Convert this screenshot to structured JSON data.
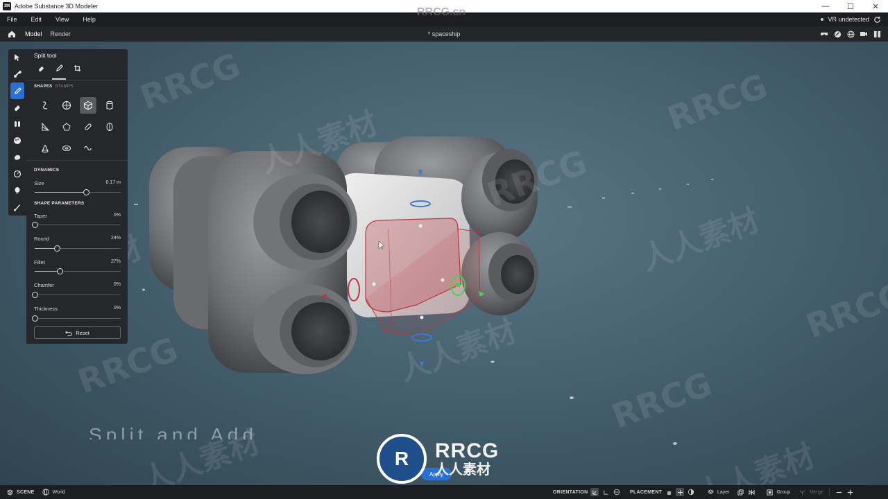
{
  "window": {
    "title": "Adobe Substance 3D Modeler",
    "app_icon_text": "3M",
    "controls": {
      "minimize": "—",
      "maximize": "☐",
      "close": "✕"
    }
  },
  "menu": {
    "items": [
      "File",
      "Edit",
      "View",
      "Help"
    ],
    "vr_status": "VR undetected"
  },
  "toolbar": {
    "tabs": [
      "Model",
      "Render"
    ],
    "active_tab": "Model",
    "document_title": "* spaceship"
  },
  "tool_panel": {
    "title": "Split tool",
    "shape_tabs": {
      "shapes": "SHAPES",
      "stamps": "STAMPS"
    },
    "dynamics": {
      "heading": "DYNAMICS",
      "size": {
        "label": "Size",
        "value": "0.17 m",
        "fraction": 0.6
      }
    },
    "shape_parameters": {
      "heading": "SHAPE PARAMETERS",
      "params": [
        {
          "label": "Taper",
          "value": "0%",
          "fraction": 0.0
        },
        {
          "label": "Round",
          "value": "24%",
          "fraction": 0.26
        },
        {
          "label": "Fillet",
          "value": "27%",
          "fraction": 0.29
        },
        {
          "label": "Chamfer",
          "value": "0%",
          "fraction": 0.0
        },
        {
          "label": "Thickness",
          "value": "0%",
          "fraction": 0.0
        }
      ]
    },
    "reset_label": "Reset"
  },
  "viewport": {
    "caption": "Split and Add",
    "apply_label": "Apply"
  },
  "watermark": {
    "latin": "RRCG",
    "site": "RRCG.cn",
    "chinese": "人人素材"
  },
  "statusbar": {
    "scene_label": "SCENE",
    "world_label": "World",
    "orientation_label": "ORIENTATION",
    "placement_label": "PLACEMENT",
    "layer_label": "Layer",
    "group_label": "Group",
    "merge_label": "Merge"
  },
  "colors": {
    "accent": "#2b6fd6",
    "split_box": "#c2343c",
    "gizmo_green": "#4fd04a",
    "gizmo_blue": "#3a7bd5"
  }
}
